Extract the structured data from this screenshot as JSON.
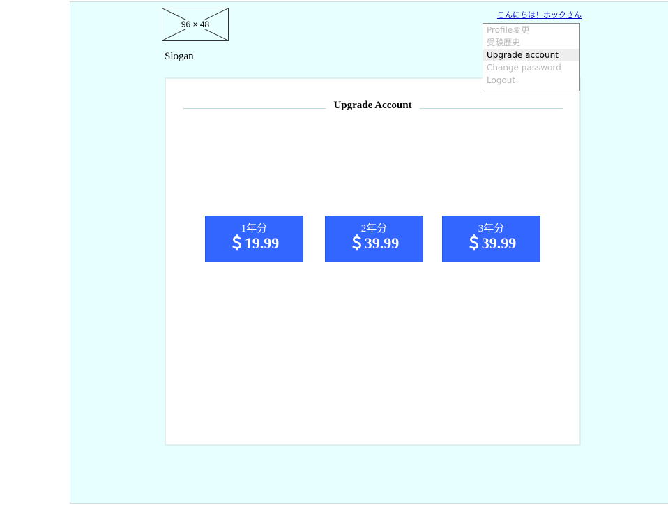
{
  "header": {
    "logo_placeholder": "96 × 48",
    "slogan": "Slogan",
    "user_greeting": "こんにちは！ホックさん"
  },
  "user_menu": {
    "items": [
      {
        "label": "Profile変更",
        "active": false
      },
      {
        "label": "受験歴史",
        "active": false
      },
      {
        "label": "Upgrade account",
        "active": true
      },
      {
        "label": "Change password",
        "active": false
      },
      {
        "label": "Logout",
        "active": false
      }
    ]
  },
  "main": {
    "title": "Upgrade Account",
    "plans": [
      {
        "duration": "1年分",
        "price": "＄19.99"
      },
      {
        "duration": "2年分",
        "price": "＄39.99"
      },
      {
        "duration": "3年分",
        "price": "＄39.99"
      }
    ]
  },
  "colors": {
    "page_background": "#e8ffff",
    "plan_button": "#3366ff",
    "link": "#0000cc"
  }
}
